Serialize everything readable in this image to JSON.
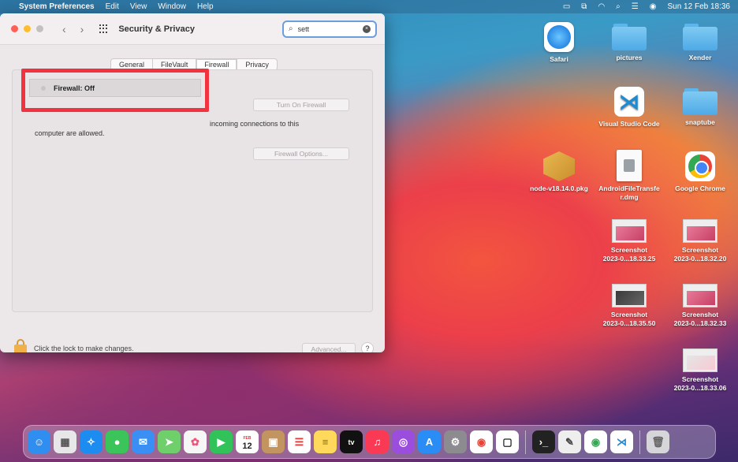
{
  "menubar": {
    "apple": "",
    "app_name": "System Preferences",
    "items": [
      "Edit",
      "View",
      "Window",
      "Help"
    ],
    "clock": "Sun 12 Feb  18:36"
  },
  "window": {
    "title": "Security & Privacy",
    "search": {
      "value": "sett"
    },
    "tabs": [
      "General",
      "FileVault",
      "Firewall",
      "Privacy"
    ],
    "active_tab": "Firewall",
    "firewall_status": "Firewall: Off",
    "turn_on_button": "Turn On Firewall",
    "description_1": "incoming connections to this",
    "description_2": "computer are allowed.",
    "options_button": "Firewall Options...",
    "lock_text": "Click the lock to make changes.",
    "advanced_button": "Advanced...",
    "help_button": "?"
  },
  "desktop": {
    "safari": "Safari",
    "pictures": "pictures",
    "xender": "Xender",
    "vscode": "Visual Studio Code",
    "snaptube": "snaptube",
    "node_pkg": "node-v18.14.0.pkg",
    "android_1": "AndroidFileTransfe",
    "android_2": "r.dmg",
    "chrome": "Google Chrome",
    "shot1_a": "Screenshot",
    "shot1_b": "2023-0...18.33.25",
    "shot2_a": "Screenshot",
    "shot2_b": "2023-0...18.32.20",
    "shot3_a": "Screenshot",
    "shot3_b": "2023-0...18.35.50",
    "shot4_a": "Screenshot",
    "shot4_b": "2023-0...18.32.33",
    "shot5_a": "Screenshot",
    "shot5_b": "2023-0...18.33.06"
  },
  "dock": {
    "calendar_day": "12",
    "calendar_month": "FEB",
    "tv_label": "tv",
    "colors": {
      "finder": "#2f8ef0",
      "launchpad": "#e7e7ea",
      "safari": "#1d8cf0",
      "messages": "#3ac45a",
      "mail": "#3a8ff5",
      "maps": "#6fcf6a",
      "photos": "#f6f6f6",
      "facetime": "#31c25a",
      "contacts": "#c29560",
      "reminders": "#ffffff",
      "notes": "#ffd95c",
      "appletv": "#111111",
      "music": "#fa3a55",
      "podcasts": "#9b4dde",
      "appstore": "#2a8df5",
      "prefs": "#8c8c90",
      "chrome": "#ffffff",
      "brackets": "#ffffff",
      "terminal": "#222222",
      "script": "#eeeeee",
      "vscode": "#ffffff",
      "trash": "#d6d6da"
    }
  }
}
